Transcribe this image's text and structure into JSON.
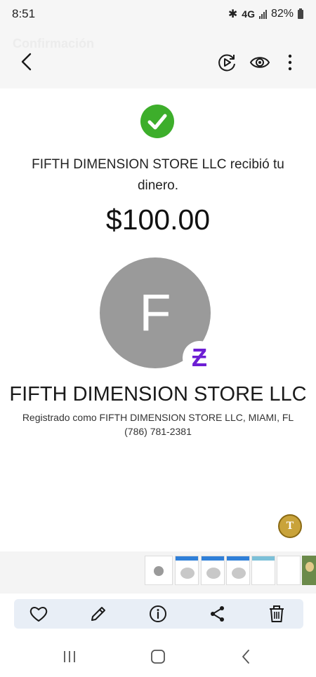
{
  "status_bar": {
    "time": "8:51",
    "network": "4G",
    "battery": "82%"
  },
  "header": {
    "title": "Confirmación"
  },
  "confirmation": {
    "message": "FIFTH DIMENSION STORE LLC recibió tu dinero.",
    "amount": "$100.00"
  },
  "recipient": {
    "initial": "F",
    "name": "FIFTH DIMENSION STORE LLC",
    "registered": "Registrado como FIFTH DIMENSION STORE LLC, MIAMI, FL",
    "phone": "(786) 781-2381"
  },
  "badge": {
    "letter": "T"
  },
  "colors": {
    "success": "#3dae2b",
    "zelle": "#6d1ed4",
    "avatar": "#9a9a9a"
  },
  "icons": {
    "toolbar": [
      "back-icon",
      "motion-photo-icon",
      "eye-icon",
      "more-vert-icon"
    ],
    "actions": [
      "heart-icon",
      "pencil-icon",
      "info-icon",
      "share-icon",
      "trash-icon"
    ],
    "nav": [
      "recent-apps-icon",
      "home-icon",
      "nav-back-icon"
    ]
  }
}
